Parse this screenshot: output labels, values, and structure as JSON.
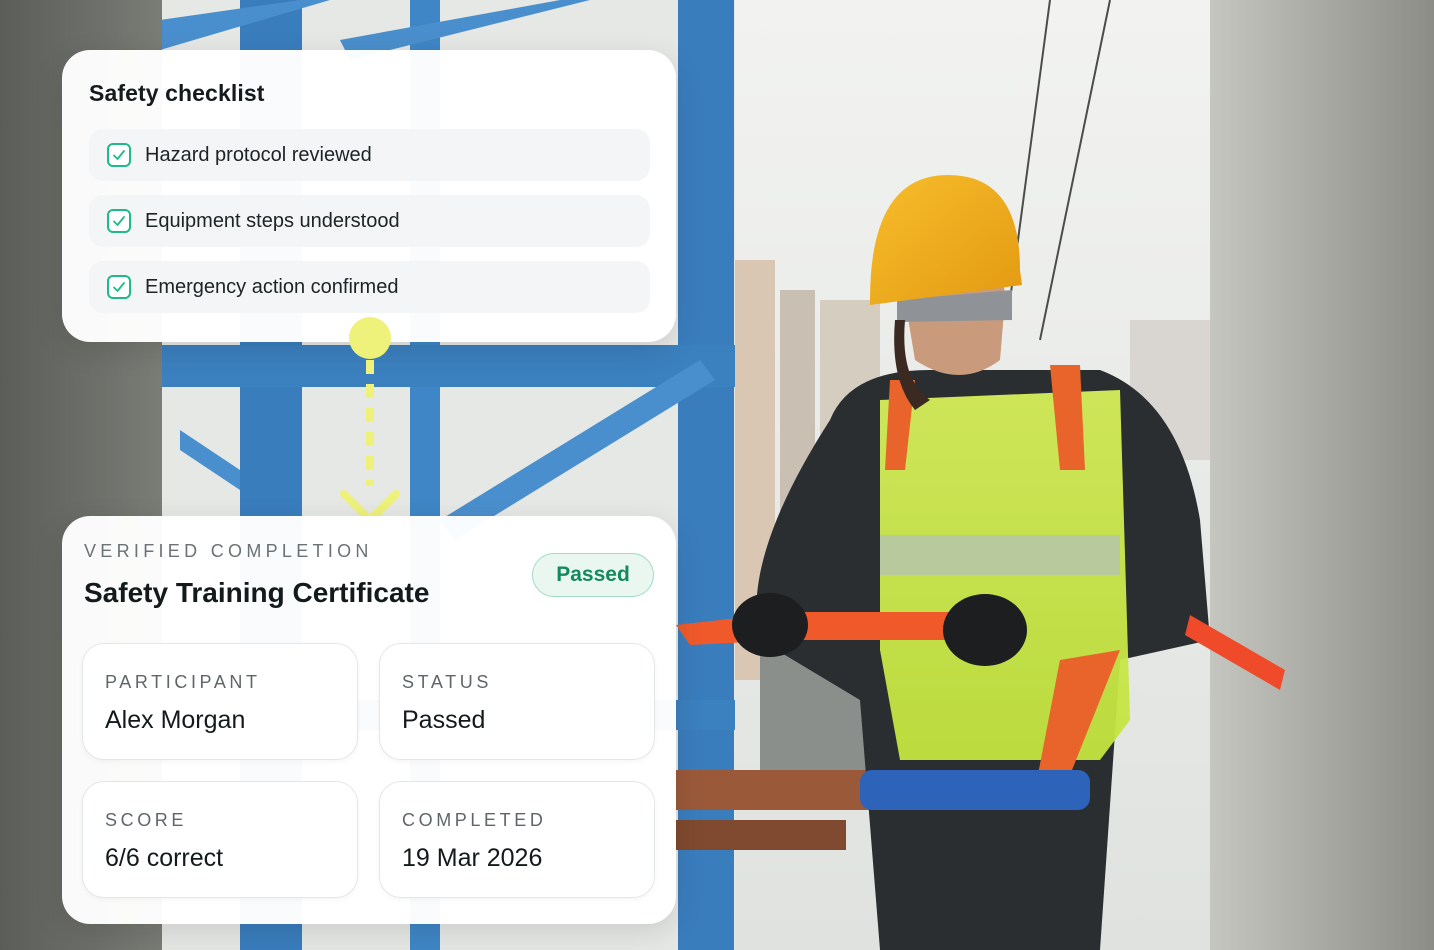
{
  "checklist": {
    "title": "Safety checklist",
    "items": [
      {
        "label": "Hazard protocol reviewed",
        "checked": true
      },
      {
        "label": "Equipment steps understood",
        "checked": true
      },
      {
        "label": "Emergency action confirmed",
        "checked": true
      }
    ]
  },
  "certificate": {
    "eyebrow": "VERIFIED COMPLETION",
    "title": "Safety Training Certificate",
    "badge": "Passed",
    "fields": [
      {
        "label": "PARTICIPANT",
        "value": "Alex Morgan"
      },
      {
        "label": "STATUS",
        "value": "Passed"
      },
      {
        "label": "SCORE",
        "value": "6/6 correct"
      },
      {
        "label": "COMPLETED",
        "value": "19 Mar 2026"
      }
    ]
  },
  "colors": {
    "check_accent": "#1fb98a",
    "badge_text": "#14895f",
    "badge_bg": "#e9f7f0",
    "connector": "#eef27a"
  }
}
